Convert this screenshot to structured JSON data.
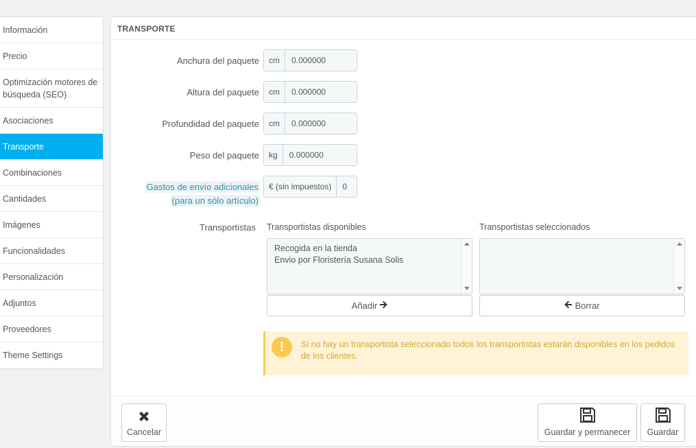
{
  "sidebar": {
    "items": [
      {
        "label": "Información"
      },
      {
        "label": "Precio"
      },
      {
        "label": "Optimización motores de búsqueda (SEO)"
      },
      {
        "label": "Asociaciones"
      },
      {
        "label": "Transporte",
        "active": true
      },
      {
        "label": "Combinaciones"
      },
      {
        "label": "Cantidades"
      },
      {
        "label": "Imágenes"
      },
      {
        "label": "Funcionalidades"
      },
      {
        "label": "Personalización"
      },
      {
        "label": "Adjuntos"
      },
      {
        "label": "Proveedores"
      },
      {
        "label": "Theme Settings"
      }
    ]
  },
  "panel": {
    "title": "TRANSPORTE",
    "fields": {
      "width": {
        "label": "Anchura del paquete",
        "unit": "cm",
        "value": "0.000000"
      },
      "height": {
        "label": "Altura del paquete",
        "unit": "cm",
        "value": "0.000000"
      },
      "depth": {
        "label": "Profundidad del paquete",
        "unit": "cm",
        "value": "0.000000"
      },
      "weight": {
        "label": "Peso del paquete",
        "unit": "kg",
        "value": "0.000000"
      },
      "extra_shipping": {
        "label_line1": "Gastos de envío adicionales",
        "label_line2": "(para un sólo artículo)",
        "unit": "€ (sin impuestos)",
        "value": "0"
      }
    },
    "carriers": {
      "label": "Transportistas",
      "available_label": "Transportistas disponibles",
      "selected_label": "Transportistas seleccionados",
      "available": [
        "Recogida en la tienda",
        "Envio por Floristería Susana Solis"
      ],
      "add_label": "Añadir",
      "remove_label": "Borrar"
    },
    "alert": "Si no hay un transportista seleccionado todos los transportistas estarán disponibles en los pedidos de los clientes.",
    "footer": {
      "cancel_label": "Cancelar",
      "save_stay_label": "Guardar y permanecer",
      "save_label": "Guardar"
    }
  },
  "colors": {
    "active": "#00aff0",
    "alert_bg": "#fff3d7",
    "alert_text": "#d2a63c",
    "help_link": "#2f8fb6"
  }
}
